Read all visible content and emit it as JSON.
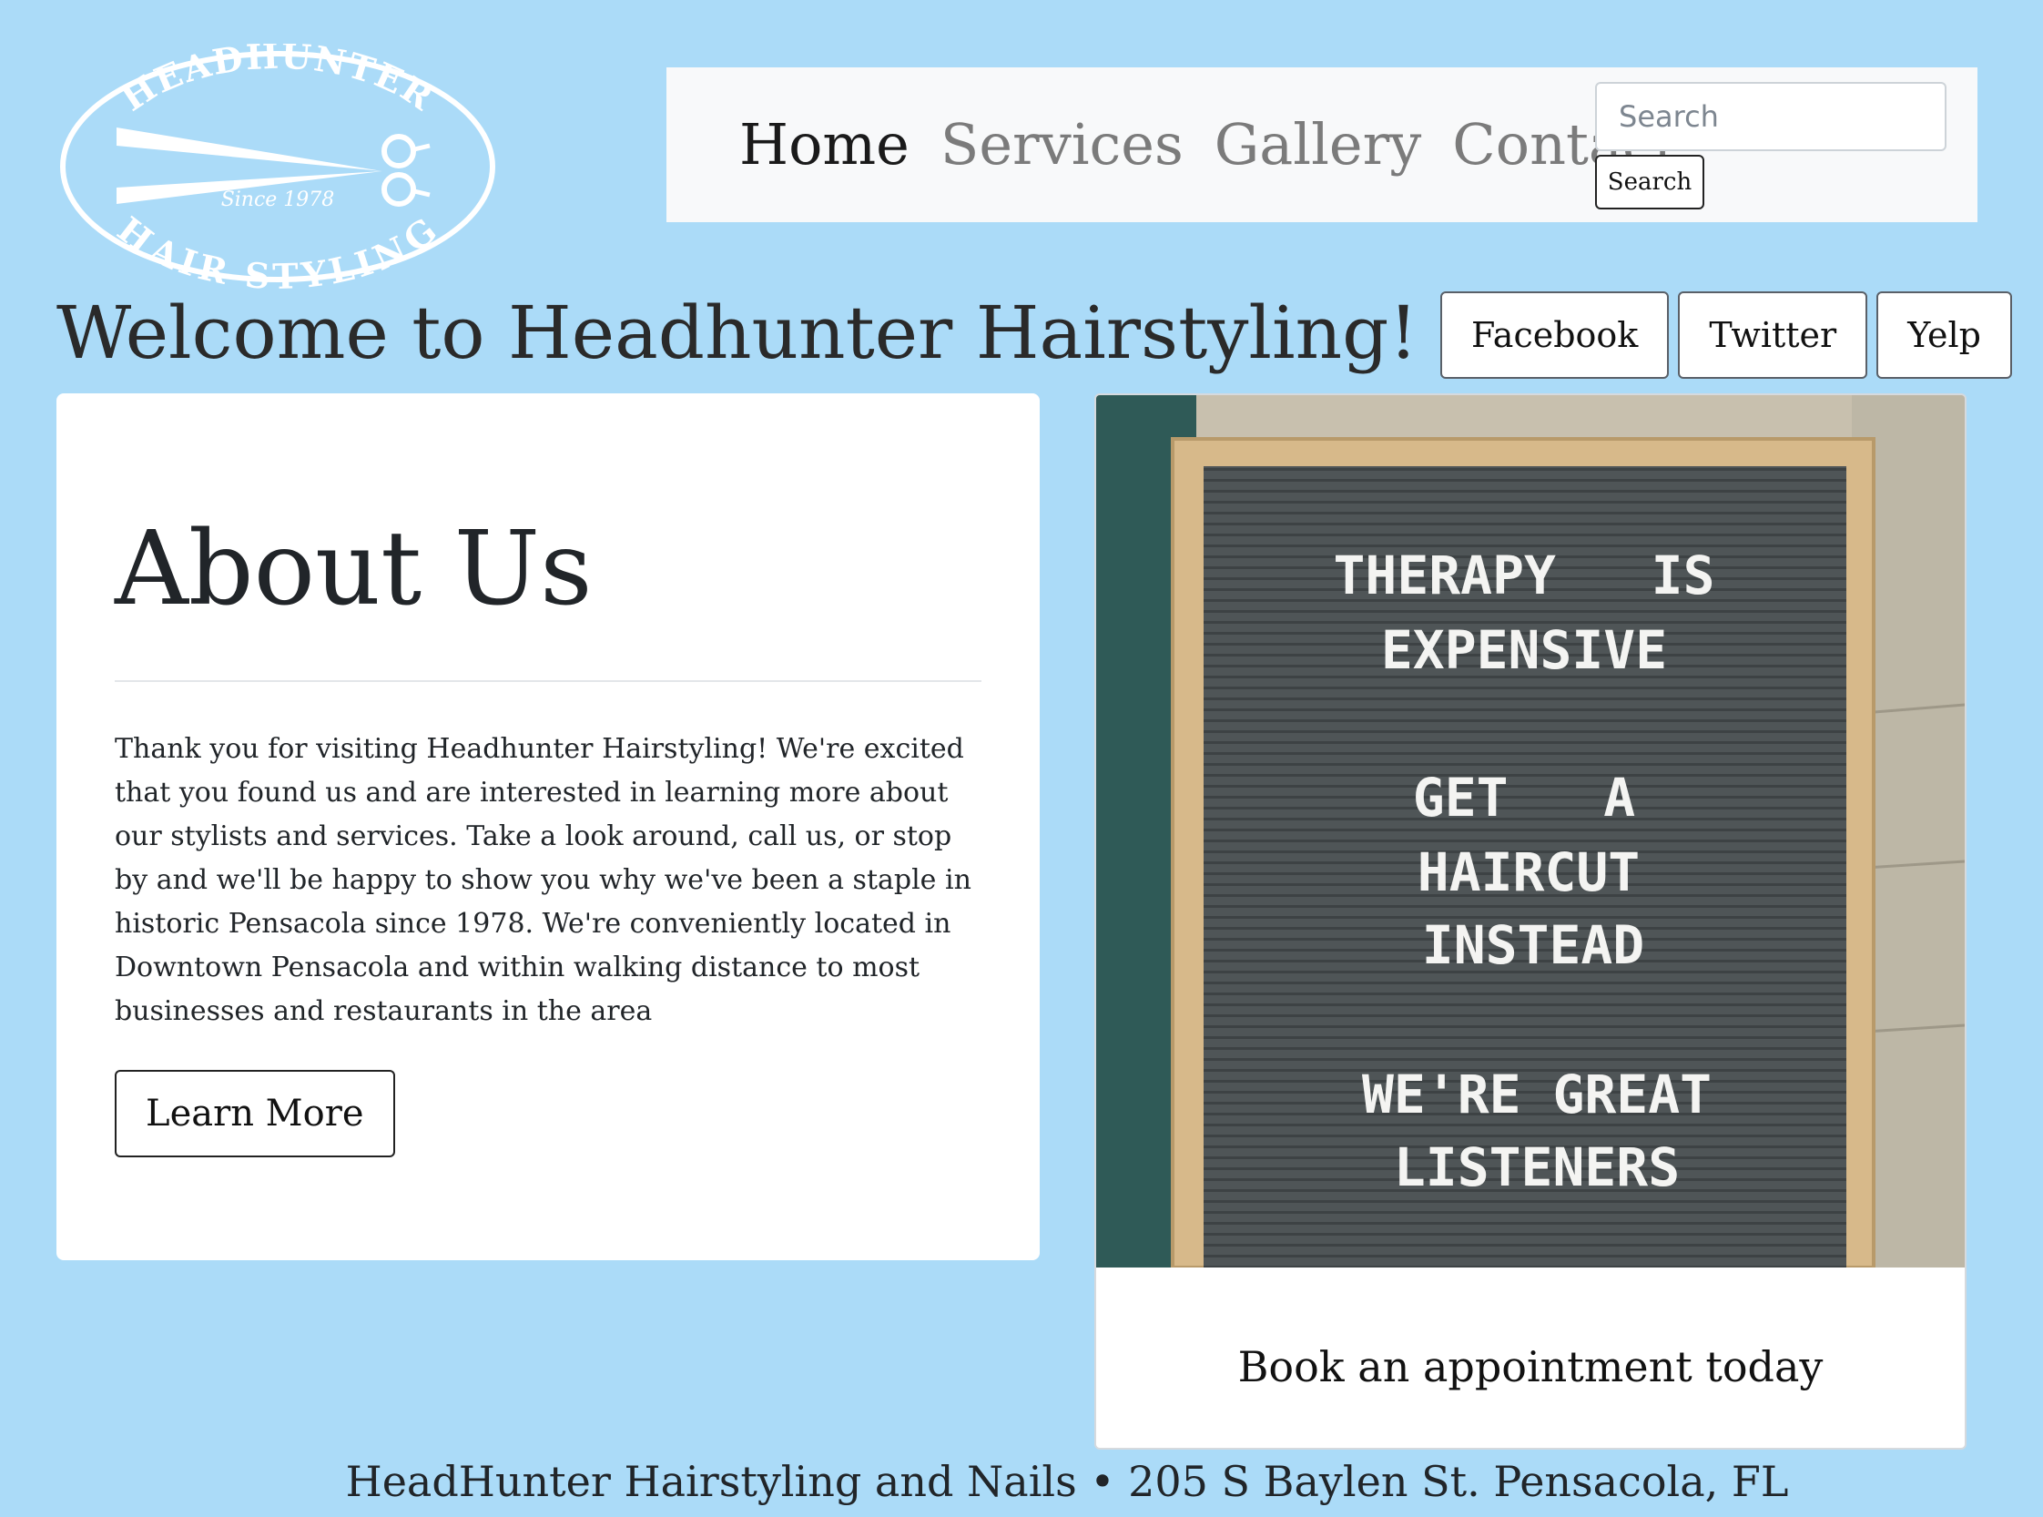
{
  "logo": {
    "top_text": "HEADHUNTER",
    "bottom_text": "HAIR STYLING",
    "tagline": "Since 1978"
  },
  "nav": {
    "items": [
      {
        "label": "Home",
        "active": true
      },
      {
        "label": "Services",
        "active": false
      },
      {
        "label": "Gallery",
        "active": false
      },
      {
        "label": "Contact",
        "active": false
      }
    ],
    "search": {
      "placeholder": "Search",
      "button_label": "Search"
    }
  },
  "page_title": "Welcome to Headhunter Hairstyling!",
  "social": {
    "facebook": "Facebook",
    "twitter": "Twitter",
    "yelp": "Yelp"
  },
  "about": {
    "title": "About Us",
    "text": "Thank you for visiting Headhunter Hairstyling! We're excited that you found us and are interested in learning more about our stylists and services. Take a look around, call us, or stop by and we'll be happy to show you why we've been a staple in historic Pensacola since 1978. We're conveniently located in Downtown Pensacola and within walking distance to most businesses and restaurants in the area",
    "button_label": "Learn More"
  },
  "promo": {
    "board_lines": [
      "THERAPY   IS",
      "EXPENSIVE",
      "GET   A",
      "HAIRCUT",
      "INSTEAD",
      "WE'RE GREAT",
      "LISTENERS"
    ],
    "caption": "Book an appointment today"
  },
  "footer": "HeadHunter Hairstyling and Nails • 205 S Baylen St. Pensacola, FL",
  "colors": {
    "page_background": "#abdbf8",
    "navbar_background": "#f8f9fa",
    "letterboard": "#4f5557",
    "frame_wood": "#d7b98a"
  }
}
